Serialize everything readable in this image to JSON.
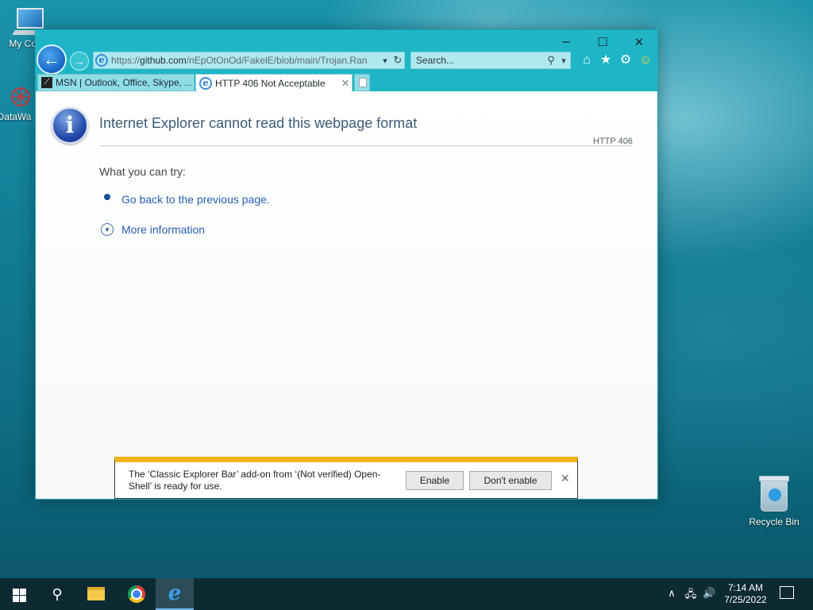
{
  "desktop": {
    "icons": [
      {
        "label": "My Con"
      },
      {
        "label": "DataWa"
      },
      {
        "label": "Recycle Bin"
      }
    ]
  },
  "browser": {
    "window_controls": {
      "minimize": "─",
      "maximize": "☐",
      "close": "✕"
    },
    "nav": {
      "back": "←",
      "forward": "→"
    },
    "address": {
      "scheme": "https://",
      "host": "github.com",
      "path": "/nEpOtOnOd/FakelE/blob/main/Trojan.Ran",
      "dropdown": "▾",
      "refresh": "↻"
    },
    "search": {
      "placeholder": "Search...",
      "icon": "⚲",
      "dropdown": "▾"
    },
    "toolbar_icons": {
      "home": "⌂",
      "favorites": "★",
      "tools": "⚙",
      "smiley": "☺"
    },
    "tabs": [
      {
        "label": "MSN | Outlook, Office, Skype, ...",
        "icon": "msn-logo",
        "active": false
      },
      {
        "label": "HTTP 406 Not Acceptable",
        "icon": "ie-icon",
        "active": true,
        "close": "✕"
      }
    ]
  },
  "page": {
    "info_glyph": "i",
    "title": "Internet Explorer cannot read this webpage format",
    "error_code": "HTTP 406",
    "try_heading": "What you can try:",
    "go_back_link": "Go back to the previous page.",
    "more_info_link": "More information",
    "more_info_glyph": "▾"
  },
  "notification": {
    "text": "The ‘Classic Explorer Bar’ add-on from ‘(Not verified) Open-Shell’ is ready for use.",
    "enable_label": "Enable",
    "dont_enable_label": "Don't enable",
    "close": "✕",
    "accent_color": "#f0b31b"
  },
  "taskbar": {
    "search_glyph": "⚲",
    "apps": [
      "file-explorer",
      "chrome",
      "internet-explorer"
    ],
    "tray": {
      "chevron": "∧",
      "network": "🖧",
      "volume": "🔊"
    },
    "clock": {
      "time": "7:14 AM",
      "date": "7/25/2022"
    }
  },
  "colors": {
    "title_bar": "#1eb6c6",
    "link": "#2a5db0",
    "heading": "#3d5a78"
  }
}
